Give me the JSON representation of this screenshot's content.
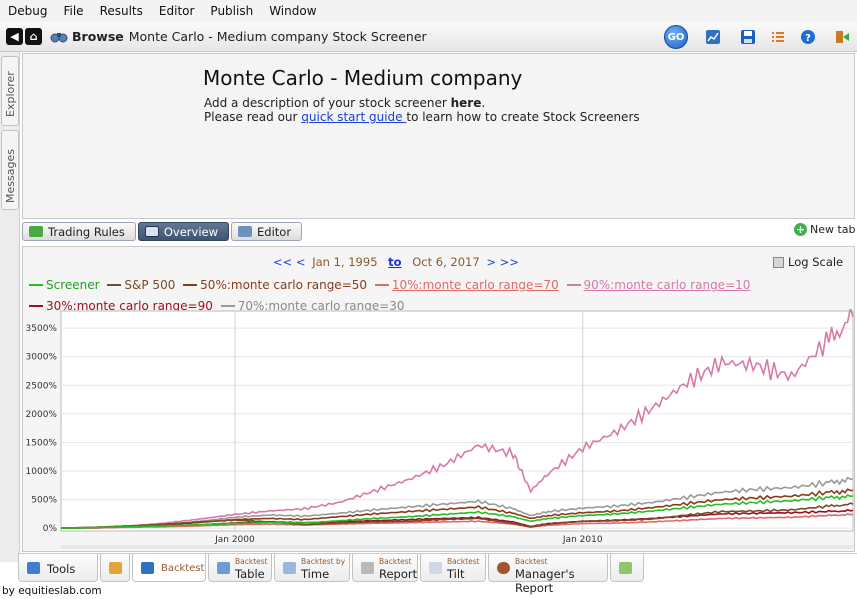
{
  "menu": [
    "Debug",
    "File",
    "Results",
    "Editor",
    "Publish",
    "Window"
  ],
  "toolbar": {
    "browse_label": "Browse",
    "browse_title": "Monte Carlo - Medium company Stock Screener",
    "go_label": "GO"
  },
  "sidebar": {
    "explorer": "Explorer",
    "messages": "Messages"
  },
  "description": {
    "title": "Monte Carlo - Medium company",
    "line1_prefix": "Add a description of your stock screener ",
    "line1_link": "here",
    "line1_suffix": ".",
    "line2_prefix": "Please read our ",
    "line2_link": "quick start guide ",
    "line2_suffix": "to learn how to create Stock Screeners"
  },
  "subtabs": {
    "trading_rules": "Trading Rules",
    "overview": "Overview",
    "editor": "Editor",
    "new_tab": "New tab"
  },
  "range": {
    "prev": "<< <",
    "start": "Jan 1, 1995",
    "to": "to",
    "end": "Oct 6, 2017",
    "next": "> >>",
    "log_scale": "Log Scale"
  },
  "bottom_tabs": {
    "tools": "Tools",
    "backtest": "Backtest",
    "table_small": "Backtest",
    "table": "Table",
    "time_small": "Backtest by",
    "time": "Time",
    "report_small": "Backtest",
    "report": "Report",
    "tilt_small": "Backtest",
    "tilt": "Tilt",
    "manager_small": "Backtest",
    "manager": "Manager's Report"
  },
  "footer": "by equitieslab.com",
  "colors": {
    "screener": "#22c022",
    "sp500": "#7a4a2a",
    "mc50": "#8b3a1a",
    "mc70": "#e06a6a",
    "mc10": "#d77aa8",
    "mc90": "#9b1020",
    "mc30": "#9a9a9a"
  },
  "chart_data": {
    "type": "line",
    "title": "",
    "xlabel": "",
    "ylabel": "",
    "x_range": [
      1995.0,
      2017.77
    ],
    "ylim": [
      -50,
      3800
    ],
    "yticks": [
      "0%",
      "500%",
      "1000%",
      "1500%",
      "2000%",
      "2500%",
      "3000%",
      "3500%"
    ],
    "xticks": [
      "Jan 2000",
      "Jan 2010"
    ],
    "grid": true,
    "legend": "top",
    "x": [
      1995,
      1996,
      1997,
      1998,
      1999,
      2000,
      2001,
      2002,
      2003,
      2004,
      2005,
      2006,
      2007,
      2008,
      2008.5,
      2009,
      2010,
      2011,
      2012,
      2013,
      2014,
      2015,
      2016,
      2017,
      2017.77
    ],
    "series": [
      {
        "name": "Screener",
        "color": "#22c022",
        "values": [
          0,
          10,
          25,
          40,
          60,
          80,
          100,
          90,
          130,
          170,
          200,
          240,
          280,
          200,
          120,
          170,
          220,
          250,
          300,
          360,
          420,
          450,
          480,
          530,
          560
        ]
      },
      {
        "name": "S&P 500",
        "color": "#7a4a2a",
        "values": [
          0,
          15,
          40,
          70,
          110,
          140,
          110,
          60,
          90,
          110,
          120,
          150,
          170,
          80,
          20,
          70,
          120,
          130,
          160,
          230,
          290,
          300,
          320,
          380,
          420
        ]
      },
      {
        "name": "50%:monte carlo range=50",
        "color": "#8b3a1a",
        "values": [
          0,
          10,
          30,
          60,
          100,
          150,
          170,
          150,
          200,
          250,
          290,
          330,
          370,
          260,
          170,
          220,
          270,
          300,
          360,
          430,
          500,
          530,
          560,
          620,
          660
        ]
      },
      {
        "name": "10%:monte carlo range=70",
        "color": "#e06a6a",
        "values": [
          0,
          5,
          15,
          25,
          40,
          60,
          70,
          55,
          70,
          85,
          95,
          110,
          120,
          70,
          20,
          50,
          80,
          90,
          110,
          140,
          170,
          180,
          190,
          220,
          240
        ]
      },
      {
        "name": "90%:monte carlo range=10",
        "color": "#d77aa8",
        "values": [
          0,
          15,
          40,
          90,
          160,
          240,
          300,
          340,
          450,
          650,
          850,
          1100,
          1450,
          1300,
          650,
          950,
          1400,
          1700,
          2100,
          2550,
          2900,
          2850,
          2650,
          3250,
          3700
        ]
      },
      {
        "name": "30%:monte carlo range=90",
        "color": "#9b1020",
        "values": [
          0,
          5,
          20,
          40,
          60,
          90,
          110,
          95,
          110,
          130,
          150,
          170,
          185,
          110,
          30,
          80,
          120,
          140,
          170,
          210,
          250,
          260,
          270,
          290,
          310
        ]
      },
      {
        "name": "70%:monte carlo range=30",
        "color": "#9a9a9a",
        "values": [
          0,
          10,
          30,
          60,
          120,
          190,
          230,
          210,
          260,
          320,
          370,
          420,
          470,
          340,
          220,
          290,
          350,
          390,
          450,
          540,
          630,
          680,
          710,
          790,
          860
        ]
      }
    ]
  }
}
